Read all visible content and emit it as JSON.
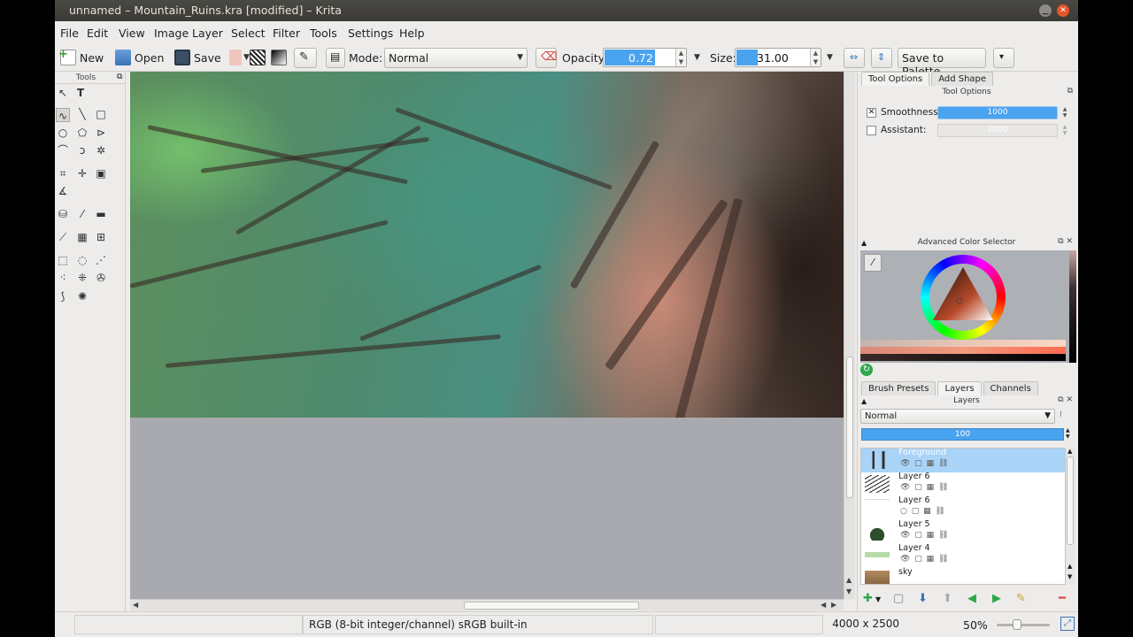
{
  "window": {
    "title": "unnamed – Mountain_Ruins.kra [modified] – Krita"
  },
  "menu": [
    "File",
    "Edit",
    "View",
    "Image",
    "Layer",
    "Select",
    "Filter",
    "Tools",
    "Settings",
    "Help"
  ],
  "toolbar": {
    "new_label": "New",
    "open_label": "Open",
    "save_label": "Save",
    "mode_label": "Mode:",
    "mode_value": "Normal",
    "opacity_label": "Opacity:",
    "opacity_value": "0.72",
    "opacity_fraction": 0.72,
    "size_label": "Size:",
    "size_value": "31.00",
    "save_to_palette_label": "Save to Palette"
  },
  "tools_dock": {
    "title": "Tools"
  },
  "right_dock": {
    "tabs_top": [
      "Tool Options",
      "Add Shape"
    ],
    "tool_options_header": "Tool Options",
    "smoothness_label": "Smoothness:",
    "smoothness_checked": true,
    "smoothness_value": "1000",
    "assistant_label": "Assistant:",
    "assistant_checked": false,
    "assistant_value": "1000",
    "color_selector_header": "Advanced Color Selector",
    "tabs_bottom": [
      "Brush Presets",
      "Layers",
      "Channels"
    ],
    "layers_header": "Layers",
    "blend_mode": "Normal",
    "layer_opacity": "100",
    "layers": [
      {
        "name": "Foreground",
        "selected": true
      },
      {
        "name": "Layer 6",
        "selected": false
      },
      {
        "name": "Layer 6",
        "selected": false
      },
      {
        "name": "Layer 5",
        "selected": false
      },
      {
        "name": "Layer 4",
        "selected": false
      },
      {
        "name": "sky",
        "selected": false
      }
    ]
  },
  "statusbar": {
    "color_model": "RGB (8-bit integer/channel)  sRGB built-in",
    "image_size": "4000 x 2500",
    "zoom": "50%"
  },
  "colors": {
    "accent": "#4aa3ee",
    "selection": "#a9d3f7",
    "titlebar": "#3b3a36"
  }
}
